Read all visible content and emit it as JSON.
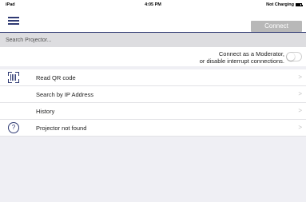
{
  "status_bar": {
    "device": "iPad",
    "time": "4:05 PM",
    "battery_status": "Not Charging",
    "battery_level": 0.75
  },
  "nav": {
    "menu_icon": "hamburger-menu-icon",
    "connect_label": "Connect"
  },
  "search": {
    "placeholder": "Search Projector..."
  },
  "moderator": {
    "line1": "Connect as a Moderator,",
    "line2": "or disable interrupt connections.",
    "enabled": false
  },
  "list": {
    "items": [
      {
        "label": "Read QR code",
        "icon": "qr-code-icon"
      },
      {
        "label": "Search by IP Address",
        "icon": ""
      },
      {
        "label": "History",
        "icon": ""
      },
      {
        "label": "Projector not found",
        "icon": "help-icon"
      }
    ],
    "chevron": ">"
  },
  "colors": {
    "accent": "#2f3a73",
    "button_disabled": "#b8b8b8",
    "background": "#efeff4"
  }
}
